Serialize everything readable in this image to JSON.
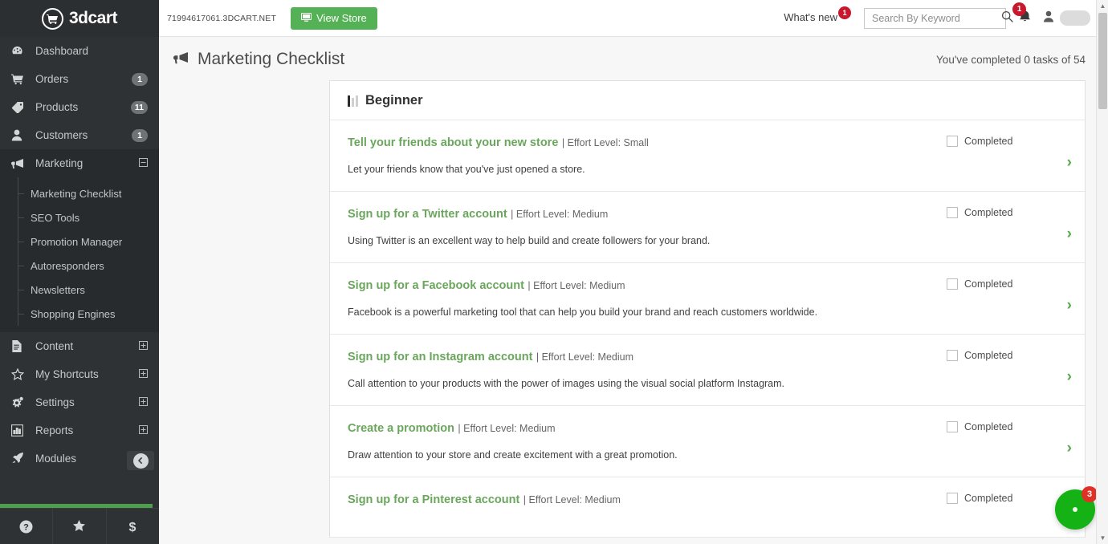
{
  "brand": {
    "name": "3dcart",
    "accent_green": "#55b155",
    "sidebar_bg": "#2e3234",
    "badge_red": "#c9182b"
  },
  "topbar": {
    "store_url": "71994617061.3DCART.NET",
    "view_store_label": "View Store",
    "whats_new_label": "What's new",
    "whats_new_badge": "1",
    "notification_badge": "1",
    "search": {
      "placeholder": "Search By Keyword",
      "value": ""
    }
  },
  "sidebar": {
    "items": [
      {
        "label": "Dashboard",
        "icon": "dashboard-icon",
        "badge": "",
        "expander": ""
      },
      {
        "label": "Orders",
        "icon": "cart-icon",
        "badge": "1",
        "expander": ""
      },
      {
        "label": "Products",
        "icon": "tag-icon",
        "badge": "11",
        "expander": ""
      },
      {
        "label": "Customers",
        "icon": "user-icon",
        "badge": "1",
        "expander": ""
      },
      {
        "label": "Marketing",
        "icon": "megaphone-icon",
        "badge": "",
        "expander": "minus"
      }
    ],
    "submenu": [
      {
        "label": "Marketing Checklist"
      },
      {
        "label": "SEO Tools"
      },
      {
        "label": "Promotion Manager"
      },
      {
        "label": "Autoresponders"
      },
      {
        "label": "Newsletters"
      },
      {
        "label": "Shopping Engines"
      }
    ],
    "items_lower": [
      {
        "label": "Content",
        "icon": "document-icon",
        "expander": "plus"
      },
      {
        "label": "My Shortcuts",
        "icon": "star-icon",
        "expander": "plus"
      },
      {
        "label": "Settings",
        "icon": "gears-icon",
        "expander": "plus"
      },
      {
        "label": "Reports",
        "icon": "bar-chart-icon",
        "expander": "plus"
      },
      {
        "label": "Modules",
        "icon": "rocket-icon",
        "expander": ""
      }
    ],
    "footer_icons": [
      "help-icon",
      "star-icon",
      "dollar-icon"
    ]
  },
  "page": {
    "title": "Marketing Checklist",
    "title_icon": "megaphone-icon",
    "completed_text": "You've completed 0 tasks of 54",
    "section_title": "Beginner",
    "section_icon": "signal-bars-icon",
    "completed_label": "Completed"
  },
  "tasks": [
    {
      "title": "Tell your friends about your new store",
      "effort": "| Effort Level: Small",
      "desc": "Let your friends know that you've just opened a store.",
      "completed": false
    },
    {
      "title": "Sign up for a Twitter account",
      "effort": "| Effort Level: Medium",
      "desc": "Using Twitter is an excellent way to help build and create followers for your brand.",
      "completed": false
    },
    {
      "title": "Sign up for a Facebook account",
      "effort": "| Effort Level: Medium",
      "desc": "Facebook is a powerful marketing tool that can help you build your brand and reach customers worldwide.",
      "completed": false
    },
    {
      "title": "Sign up for an Instagram account",
      "effort": "| Effort Level: Medium",
      "desc": "Call attention to your products with the power of images using the visual social platform Instagram.",
      "completed": false
    },
    {
      "title": "Create a promotion",
      "effort": "| Effort Level: Medium",
      "desc": "Draw attention to your store and create excitement with a great promotion.",
      "completed": false
    },
    {
      "title": "Sign up for a Pinterest account",
      "effort": "| Effort Level: Medium",
      "desc": "",
      "completed": false
    }
  ],
  "chat": {
    "badge": "3"
  }
}
